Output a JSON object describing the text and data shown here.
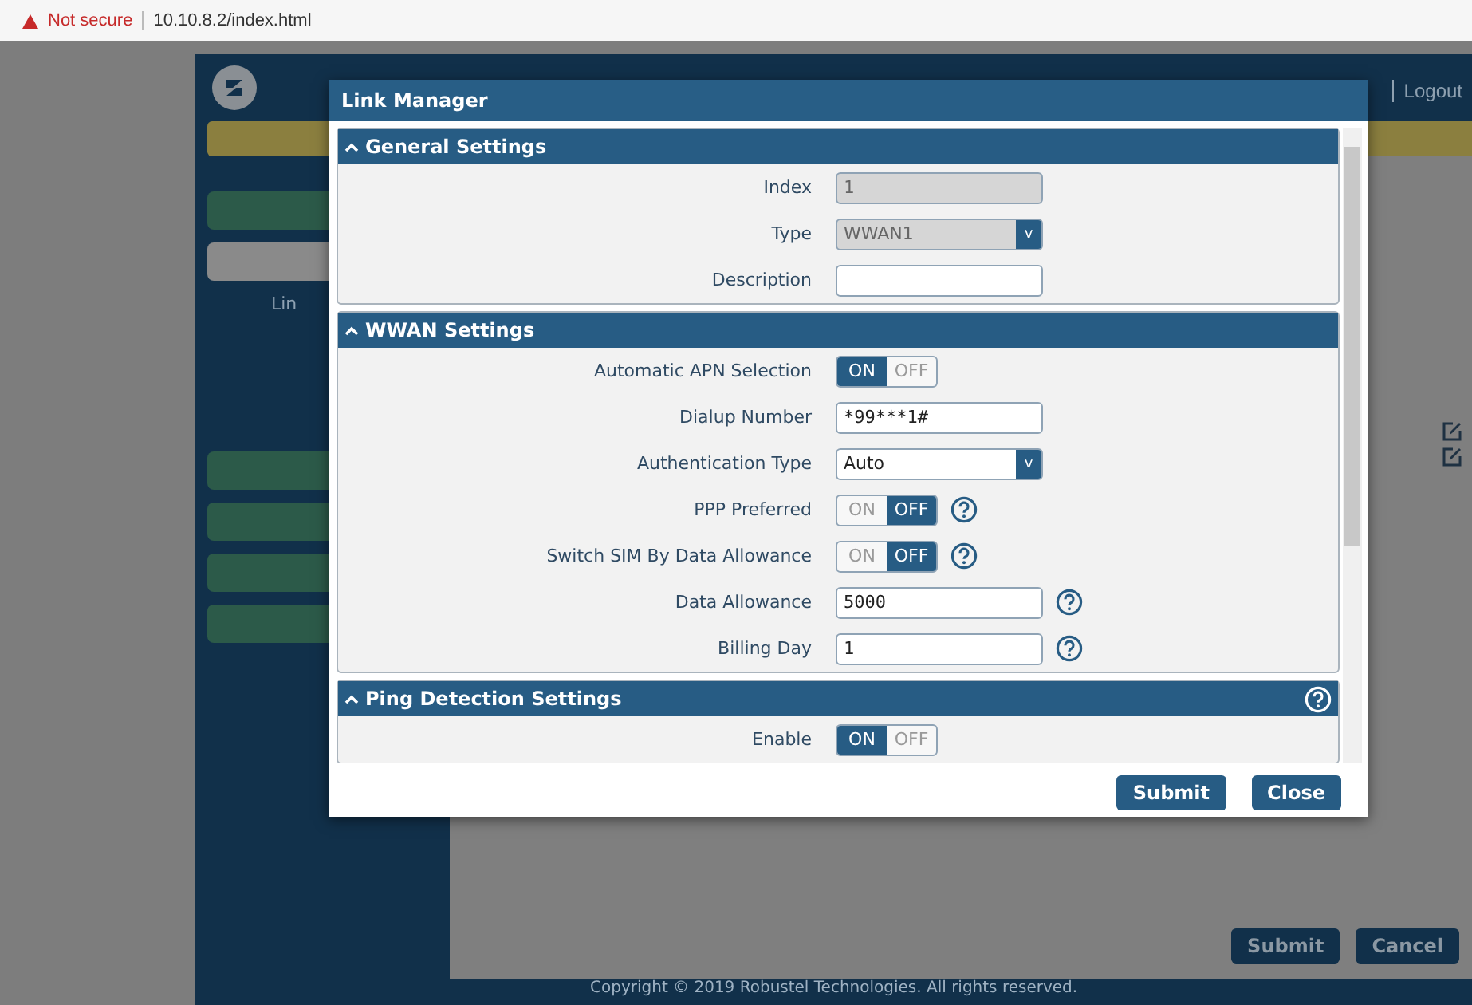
{
  "browser": {
    "security": "Not secure",
    "url": "10.10.8.2/index.html"
  },
  "header": {
    "links": [
      "Logout"
    ]
  },
  "sidebar": {
    "caption": "Lin",
    "items": [
      {
        "selected": false
      },
      {
        "selected": true
      },
      {
        "selected": false
      },
      {
        "selected": false
      },
      {
        "selected": false
      },
      {
        "selected": false
      }
    ]
  },
  "page_buttons": [
    "Submit",
    "Cancel"
  ],
  "footer": "Copyright © 2019 Robustel Technologies. All rights reserved.",
  "dialog": {
    "title": "Link Manager",
    "sections": [
      {
        "title": "General Settings",
        "help": false,
        "fields": [
          {
            "label": "Index",
            "kind": "input",
            "value": "1",
            "disabled": true,
            "help": false
          },
          {
            "label": "Type",
            "kind": "select",
            "value": "WWAN1",
            "caret": "v",
            "disabled": true,
            "help": false
          },
          {
            "label": "Description",
            "kind": "input",
            "disabled": false,
            "help": false
          }
        ]
      },
      {
        "title": "WWAN Settings",
        "help": false,
        "fields": [
          {
            "label": "Automatic APN Selection",
            "kind": "toggle",
            "on": true,
            "on_label": "ON",
            "off_label": "OFF",
            "help": false
          },
          {
            "label": "Dialup Number",
            "kind": "input",
            "value": "*99***1#",
            "disabled": false,
            "help": false
          },
          {
            "label": "Authentication Type",
            "kind": "select",
            "value": "Auto",
            "caret": "v",
            "disabled": false,
            "help": false
          },
          {
            "label": "PPP Preferred",
            "kind": "toggle",
            "on": false,
            "on_label": "ON",
            "off_label": "OFF",
            "help": true
          },
          {
            "label": "Switch SIM By Data Allowance",
            "kind": "toggle",
            "on": false,
            "on_label": "ON",
            "off_label": "OFF",
            "help": true
          },
          {
            "label": "Data Allowance",
            "kind": "input",
            "value": "5000",
            "disabled": false,
            "help": true
          },
          {
            "label": "Billing Day",
            "kind": "input",
            "value": "1",
            "disabled": false,
            "help": true
          }
        ]
      },
      {
        "title": "Ping Detection Settings",
        "help": true,
        "fields": [
          {
            "label": "Enable",
            "kind": "toggle",
            "on": true,
            "on_label": "ON",
            "off_label": "OFF",
            "help": false
          }
        ]
      }
    ],
    "buttons": [
      "Submit",
      "Close"
    ]
  }
}
